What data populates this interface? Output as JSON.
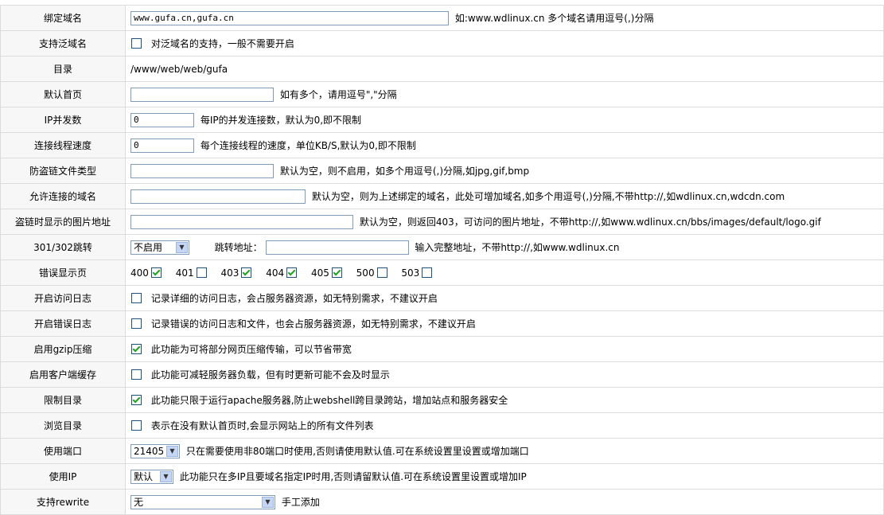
{
  "rows": {
    "domain": {
      "label": "绑定域名",
      "value": "www.gufa.cn,gufa.cn",
      "hint": "如:www.wdlinux.cn 多个域名请用逗号(,)分隔"
    },
    "wildcard": {
      "label": "支持泛域名",
      "hint": "对泛域名的支持，一般不需要开启",
      "checked": false
    },
    "dir": {
      "label": "目录",
      "value": "/www/web/web/gufa"
    },
    "index": {
      "label": "默认首页",
      "value": "",
      "hint": "如有多个，请用逗号\",\"分隔"
    },
    "ipconn": {
      "label": "IP并发数",
      "value": "0",
      "hint": "每IP的并发连接数，默认为0,即不限制"
    },
    "speed": {
      "label": "连接线程速度",
      "value": "0",
      "hint": "每个连接线程的速度，单位KB/S,默认为0,即不限制"
    },
    "antileech": {
      "label": "防盗链文件类型",
      "value": "",
      "hint": "默认为空，则不启用，如多个用逗号(,)分隔,如jpg,gif,bmp"
    },
    "allowdomain": {
      "label": "允许连接的域名",
      "value": "",
      "hint": "默认为空，则为上述绑定的域名，此处可增加域名,如多个用逗号(,)分隔,不带http://,如wdlinux.cn,wdcdn.com"
    },
    "leechimg": {
      "label": "盗链时显示的图片地址",
      "value": "",
      "hint": "默认为空，则返回403，可访问的图片地址，不带http://,如www.wdlinux.cn/bbs/images/default/logo.gif"
    },
    "redirect": {
      "label": "301/302跳转",
      "select": "不启用",
      "addr_label": "跳转地址：",
      "value": "",
      "hint": "输入完整地址，不带http://,如www.wdlinux.cn"
    },
    "errorpage": {
      "label": "错误显示页",
      "pages": [
        {
          "code": "400",
          "checked": true
        },
        {
          "code": "401",
          "checked": false
        },
        {
          "code": "403",
          "checked": true
        },
        {
          "code": "404",
          "checked": true
        },
        {
          "code": "405",
          "checked": true
        },
        {
          "code": "500",
          "checked": false
        },
        {
          "code": "503",
          "checked": false
        }
      ]
    },
    "accesslog": {
      "label": "开启访问日志",
      "hint": "记录详细的访问日志，会占服务器资源，如无特别需求，不建议开启",
      "checked": false
    },
    "errorlog": {
      "label": "开启错误日志",
      "hint": "记录错误的访问日志和文件，也会占服务器资源，如无特别需求，不建议开启",
      "checked": false
    },
    "gzip": {
      "label": "启用gzip压缩",
      "hint": "此功能为可将部分网页压缩传输，可以节省带宽",
      "checked": true
    },
    "cache": {
      "label": "启用客户端缓存",
      "hint": "此功能可减轻服务器负载，但有时更新可能不会及时显示",
      "checked": false
    },
    "limitdir": {
      "label": "限制目录",
      "hint": "此功能只限于运行apache服务器,防止webshell跨目录跨站，增加站点和服务器安全",
      "checked": true
    },
    "browse": {
      "label": "浏览目录",
      "hint": "表示在没有默认首页时,会显示网站上的所有文件列表",
      "checked": false
    },
    "port": {
      "label": "使用端口",
      "select": "21405",
      "hint": "只在需要使用非80端口时使用,否则请使用默认值.可在系统设置里设置或增加端口"
    },
    "useip": {
      "label": "使用IP",
      "select": "默认",
      "hint": "此功能只在多IP且要域名指定IP时用,否则请留默认值.可在系统设置里设置或增加IP"
    },
    "rewrite": {
      "label": "支持rewrite",
      "select": "无",
      "hint": "手工添加"
    }
  },
  "icons": {
    "dropdown": "chevron-down-icon",
    "checkbox": "checkmark-icon"
  },
  "colors": {
    "border": "#dcdcdc",
    "label_bg": "#f7f7f7",
    "check": "#21a121",
    "input_border": "#7f9db9"
  }
}
